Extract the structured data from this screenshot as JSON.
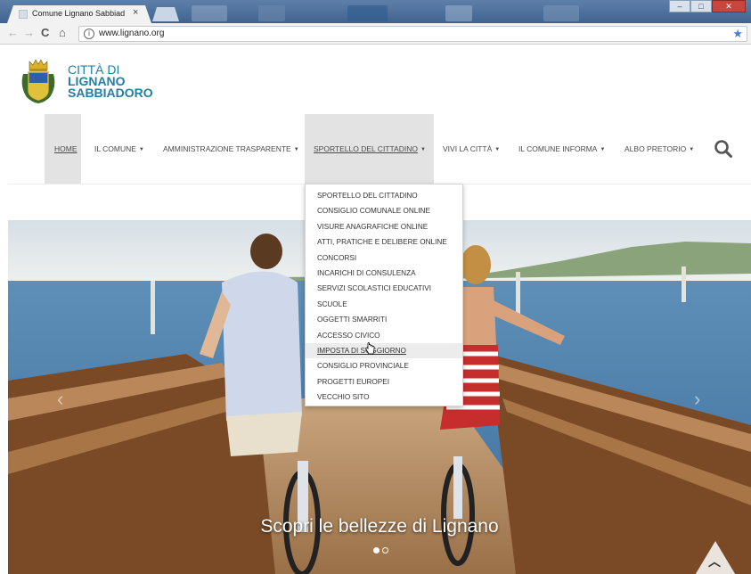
{
  "browser": {
    "tab_title": "Comune Lignano Sabbiad",
    "tab_close": "×",
    "url": "www.lignano.org",
    "info_icon": "info-icon",
    "star_icon": "bookmark-star-icon"
  },
  "site": {
    "brand_line1": "CITTÀ DI",
    "brand_line2": "LIGNANO",
    "brand_line3": "SABBIADORO",
    "brand_color": "#1f7fa6"
  },
  "nav": {
    "items": [
      {
        "label": "HOME",
        "has_caret": false
      },
      {
        "label": "IL COMUNE",
        "has_caret": true
      },
      {
        "label": "AMMINISTRAZIONE TRASPARENTE",
        "has_caret": true
      },
      {
        "label": "SPORTELLO DEL CITTADINO",
        "has_caret": true
      },
      {
        "label": "VIVI LA CITTÀ",
        "has_caret": true
      },
      {
        "label": "IL COMUNE INFORMA",
        "has_caret": true
      },
      {
        "label": "ALBO PRETORIO",
        "has_caret": true
      }
    ],
    "search_icon": "search-icon"
  },
  "dropdown": {
    "items": [
      "SPORTELLO DEL CITTADINO",
      "CONSIGLIO COMUNALE ONLINE",
      "VISURE ANAGRAFICHE ONLINE",
      "ATTI, PRATICHE E DELIBERE ONLINE",
      "CONCORSI",
      "INCARICHI DI CONSULENZA",
      "SERVIZI SCOLASTICI EDUCATIVI",
      "SCUOLE",
      "OGGETTI SMARRITI",
      "ACCESSO CIVICO",
      "IMPOSTA DI SOGGIORNO",
      "CONSIGLIO PROVINCIALE",
      "PROGETTI EUROPEI",
      "VECCHIO SITO"
    ],
    "hovered_item": "IMPOSTA DI SOGGIORNO"
  },
  "hero": {
    "caption": "Scopri le bellezze di Lignano",
    "slide_count": 2,
    "active_slide": 1
  }
}
